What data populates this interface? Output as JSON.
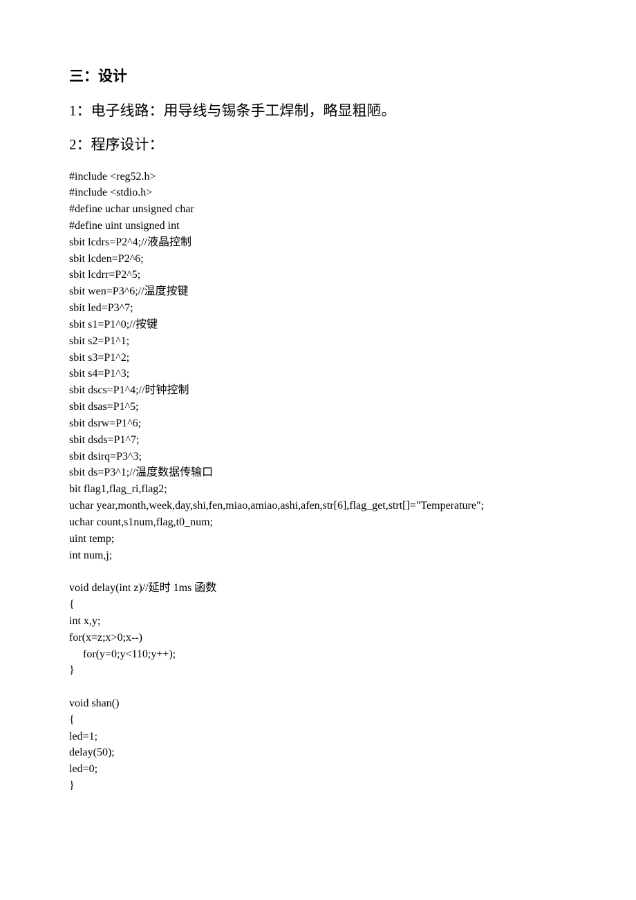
{
  "heading_main": "三：设计",
  "heading_sub1": "1：电子线路：用导线与锡条手工焊制，略显粗陋。",
  "heading_sub2": "2：程序设计：",
  "code": "#include <reg52.h>\n#include <stdio.h>\n#define uchar unsigned char\n#define uint unsigned int\nsbit lcdrs=P2^4;//液晶控制\nsbit lcden=P2^6;\nsbit lcdrr=P2^5;\nsbit wen=P3^6;//温度按键\nsbit led=P3^7;\nsbit s1=P1^0;//按键\nsbit s2=P1^1;\nsbit s3=P1^2;\nsbit s4=P1^3;\nsbit dscs=P1^4;//时钟控制\nsbit dsas=P1^5;\nsbit dsrw=P1^6;\nsbit dsds=P1^7;\nsbit dsirq=P3^3;\nsbit ds=P3^1;//温度数据传输口\nbit flag1,flag_ri,flag2;\nuchar year,month,week,day,shi,fen,miao,amiao,ashi,afen,str[6],flag_get,strt[]=\"Temperature\";\nuchar count,s1num,flag,t0_num;\nuint temp;\nint num,j;\n\nvoid delay(int z)//延时 1ms 函数\n{\nint x,y;\nfor(x=z;x>0;x--)\n     for(y=0;y<110;y++);\n}\n\nvoid shan()\n{\nled=1;\ndelay(50);\nled=0;\n}"
}
